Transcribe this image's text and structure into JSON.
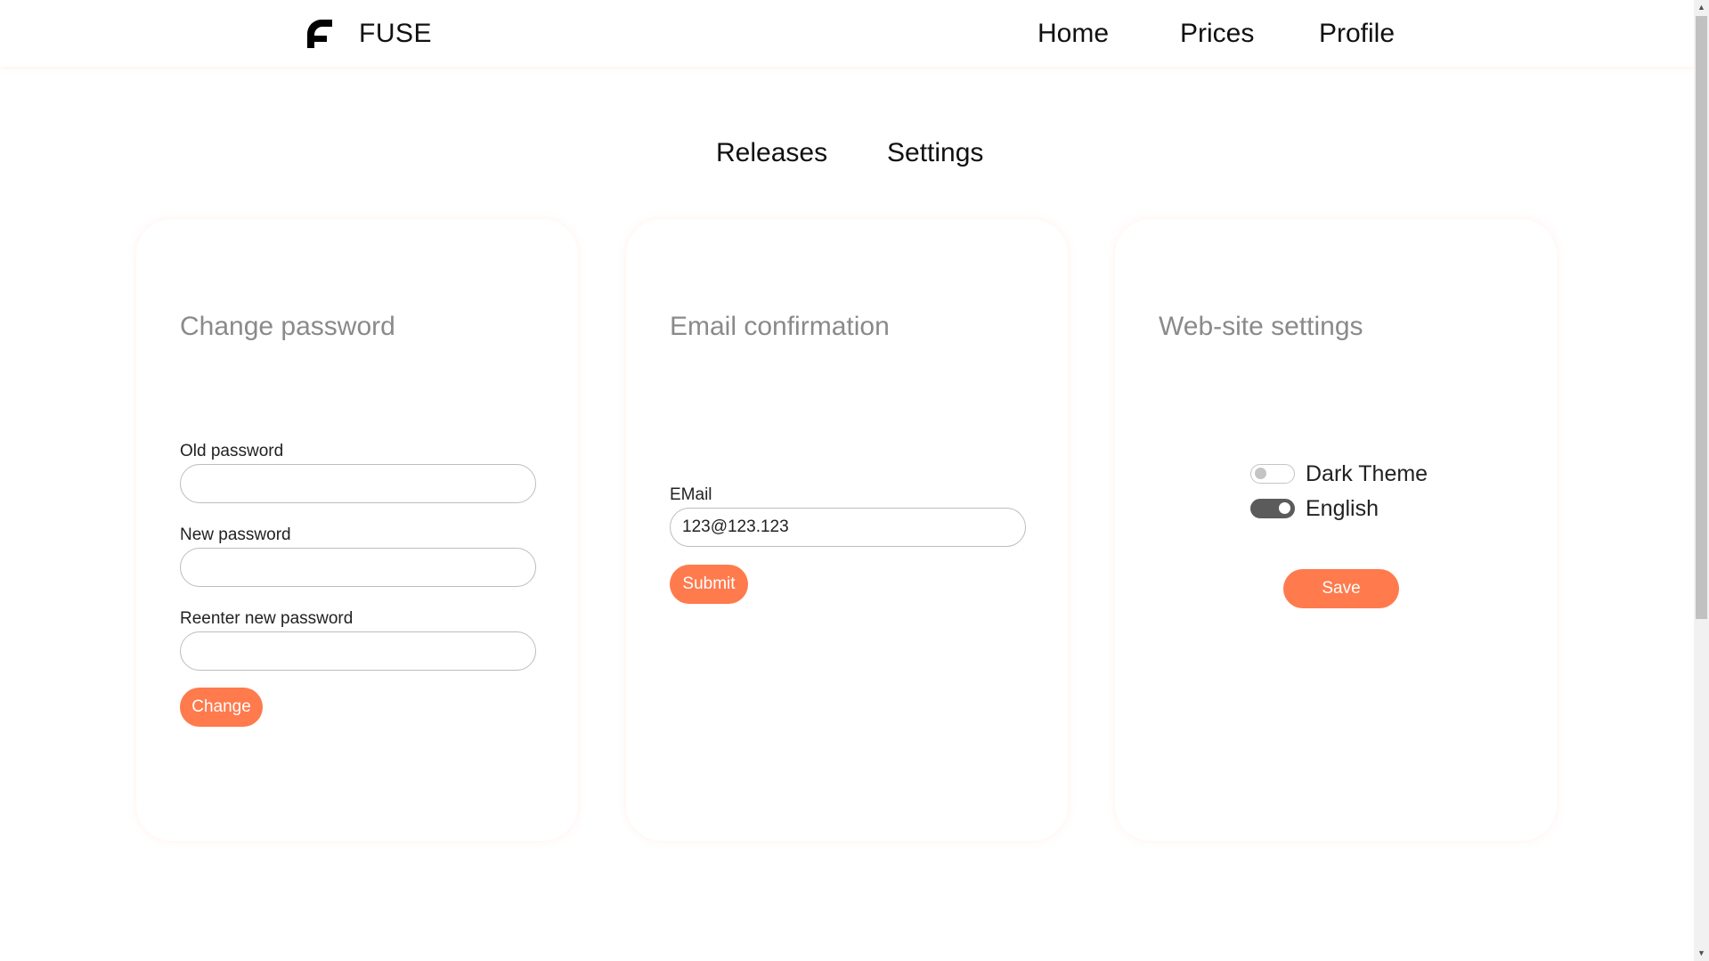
{
  "header": {
    "brand": "FUSE",
    "logo_icon": "fuse-logo-icon",
    "nav": [
      {
        "label": "Home"
      },
      {
        "label": "Prices"
      },
      {
        "label": "Profile"
      }
    ]
  },
  "subnav": {
    "tabs": [
      {
        "label": "Releases"
      },
      {
        "label": "Settings"
      }
    ]
  },
  "change_password": {
    "title": "Change password",
    "old_label": "Old password",
    "old_value": "",
    "new_label": "New password",
    "new_value": "",
    "reenter_label": "Reenter new password",
    "reenter_value": "",
    "button_label": "Change"
  },
  "email_confirmation": {
    "title": "Email confirmation",
    "email_label": "EMail",
    "email_value": "123@123.123",
    "button_label": "Submit"
  },
  "site_settings": {
    "title": "Web-site settings",
    "toggles": [
      {
        "label": "Dark Theme",
        "checked": false
      },
      {
        "label": "English",
        "checked": true
      }
    ],
    "button_label": "Save"
  },
  "colors": {
    "accent": "#ff7a4d",
    "card_title": "#8a8a8a",
    "toggle_on": "#5b5b5b"
  }
}
